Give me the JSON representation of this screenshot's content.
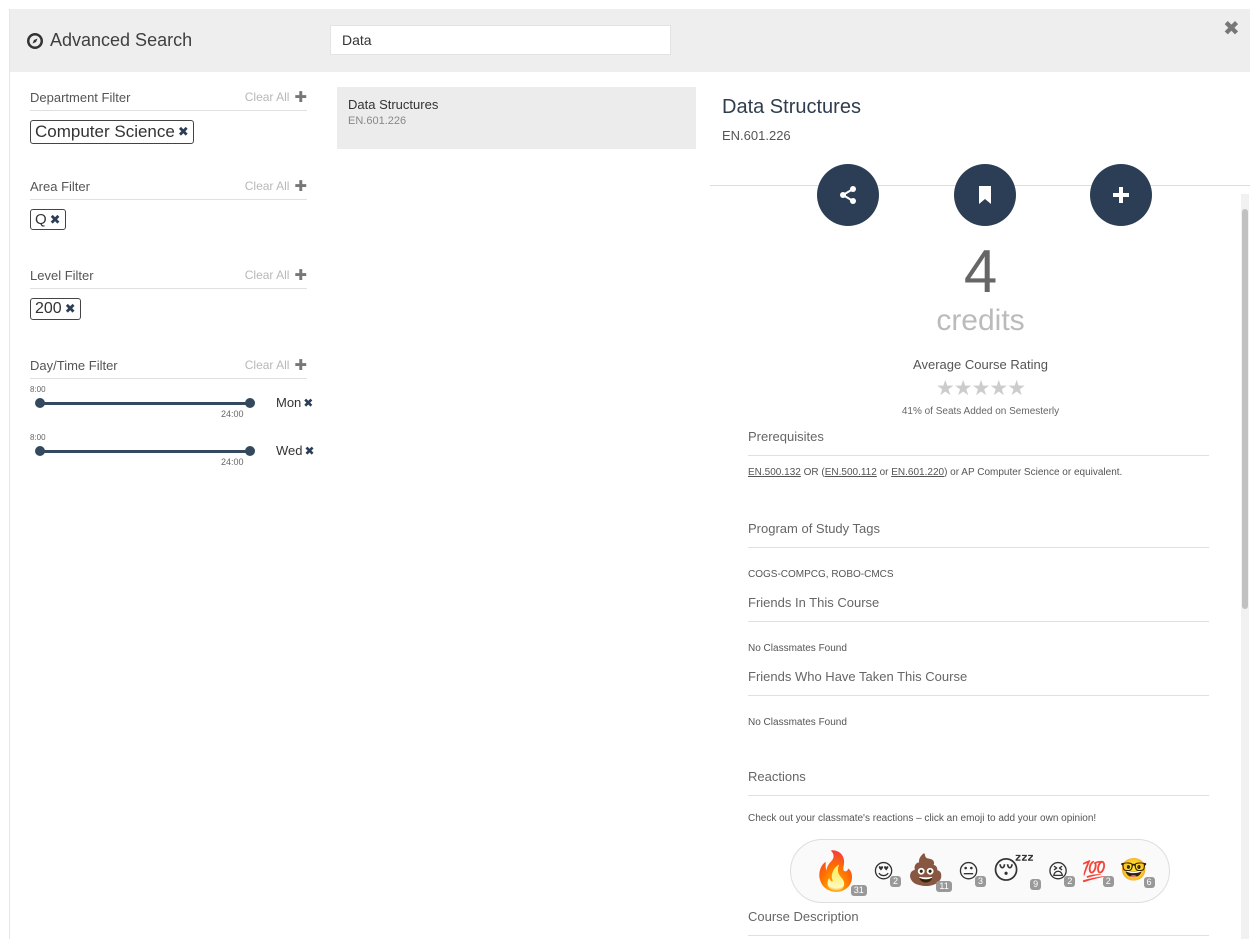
{
  "header": {
    "title": "Advanced Search",
    "search_value": "Data",
    "close_icon": "close-icon"
  },
  "filters": [
    {
      "label": "Department Filter",
      "clear": "Clear All",
      "chips": [
        "Computer Science"
      ]
    },
    {
      "label": "Area Filter",
      "clear": "Clear All",
      "chips": [
        "Q"
      ]
    },
    {
      "label": "Level Filter",
      "clear": "Clear All",
      "chips": [
        "200"
      ]
    },
    {
      "label": "Day/Time Filter",
      "clear": "Clear All",
      "sliders": [
        {
          "start": "8:00",
          "end": "24:00",
          "day": "Mon"
        },
        {
          "start": "8:00",
          "end": "24:00",
          "day": "Wed"
        }
      ]
    }
  ],
  "results": [
    {
      "title": "Data Structures",
      "code": "EN.601.226"
    }
  ],
  "detail": {
    "title": "Data Structures",
    "code": "EN.601.226",
    "credits": "4",
    "credits_label": "credits",
    "avg_rating_label": "Average Course Rating",
    "stars": "★★★★★",
    "seats_text": "41% of Seats Added on Semesterly",
    "sections": {
      "prereq": "Prerequisites",
      "prereq_parts": [
        "EN.500.132",
        " OR (",
        "EN.500.112",
        " or ",
        "EN.601.220",
        ") or AP Computer Science or equivalent."
      ],
      "tags": "Program of Study Tags",
      "tags_text": "COGS-COMPCG, ROBO-CMCS",
      "friends_in": "Friends In This Course",
      "friends_in_text": "No Classmates Found",
      "friends_taken": "Friends Who Have Taken This Course",
      "friends_taken_text": "No Classmates Found",
      "reactions": "Reactions",
      "reactions_text": "Check out your classmate's reactions – click an emoji to add your own opinion!",
      "description": "Course Description"
    },
    "reactions": [
      {
        "name": "fire",
        "glyph": "🔥",
        "count": "31",
        "size": 38
      },
      {
        "name": "heart-eyes",
        "glyph": "😍",
        "count": "2",
        "size": 20
      },
      {
        "name": "poop",
        "glyph": "💩",
        "count": "11",
        "size": 30
      },
      {
        "name": "neutral-face",
        "glyph": "😐",
        "count": "3",
        "size": 20
      },
      {
        "name": "sleeping",
        "glyph": "😴",
        "count": "9",
        "size": 26
      },
      {
        "name": "weary",
        "glyph": "😫",
        "count": "2",
        "size": 20
      },
      {
        "name": "hundred",
        "glyph": "💯",
        "count": "2",
        "size": 20
      },
      {
        "name": "nerd",
        "glyph": "🤓",
        "count": "6",
        "size": 22
      }
    ]
  }
}
